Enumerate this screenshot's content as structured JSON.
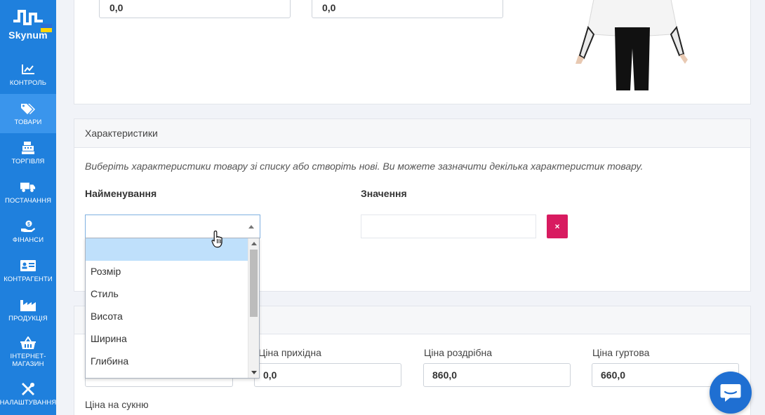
{
  "brand": {
    "name": "Skynum"
  },
  "sidebar": {
    "items": [
      {
        "label": "КОНТРОЛЬ",
        "icon": "chart-icon"
      },
      {
        "label": "ТОВАРИ",
        "icon": "tags-icon",
        "active": true
      },
      {
        "label": "ТОРГІВЛЯ",
        "icon": "cash-register-icon"
      },
      {
        "label": "ПОСТАЧАННЯ",
        "icon": "truck-icon"
      },
      {
        "label": "ФІНАНСИ",
        "icon": "hand-coin-icon"
      },
      {
        "label": "КОНТРАГЕНТИ",
        "icon": "id-card-icon"
      },
      {
        "label": "ПРОДУКЦІЯ",
        "icon": "factory-icon"
      },
      {
        "label": "ІНТЕРНЕТ-\nМАГАЗИН",
        "icon": "basket-icon"
      },
      {
        "label": "НАЛАШТУВАННЯ",
        "icon": "tools-icon"
      }
    ]
  },
  "top_panel": {
    "input_1": "0,0",
    "input_2": "0,0"
  },
  "characteristics": {
    "title": "Характеристики",
    "hint": "Виберіть характеристики товару зі списку або створіть нові. Ви можете зазначити декілька характеристик товару.",
    "name_label": "Найменування",
    "value_label": "Значення",
    "delete_label": "×",
    "dropdown_options": [
      "",
      "Розмір",
      "Стиль",
      "Висота",
      "Ширина",
      "Глибина"
    ]
  },
  "prices": {
    "purchase_label": "Ціна прихідна",
    "purchase_value": "0,0",
    "retail_label": "Ціна роздрібна",
    "retail_value": "860,0",
    "wholesale_label": "Ціна гуртова",
    "wholesale_value": "660,0",
    "dress_label": "Ціна на сукню"
  },
  "colors": {
    "sidebar": "#1f80dd",
    "active": "#3a95ec",
    "danger": "#d81b60",
    "chat": "#1f6fd2"
  }
}
